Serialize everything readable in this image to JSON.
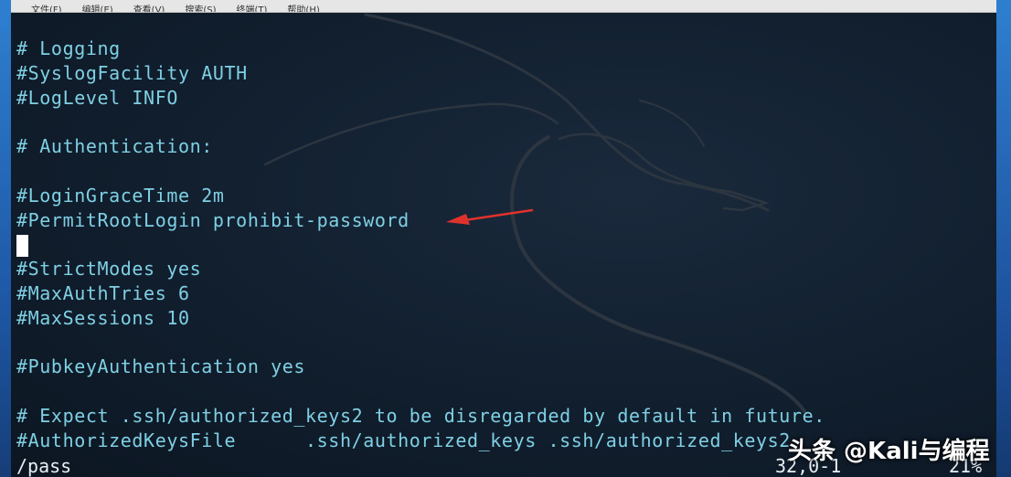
{
  "menubar": {
    "items": [
      "文件(F)",
      "编辑(E)",
      "查看(V)",
      "搜索(S)",
      "终端(T)",
      "帮助(H)"
    ]
  },
  "editor": {
    "lines": [
      "# Logging",
      "#SyslogFacility AUTH",
      "#LogLevel INFO",
      "",
      "# Authentication:",
      "",
      "#LoginGraceTime 2m",
      "#PermitRootLogin prohibit-password",
      "",
      "#StrictModes yes",
      "#MaxAuthTries 6",
      "#MaxSessions 10",
      "",
      "#PubkeyAuthentication yes",
      "",
      "# Expect .ssh/authorized_keys2 to be disregarded by default in future.",
      "#AuthorizedKeysFile      .ssh/authorized_keys .ssh/authorized_keys2"
    ],
    "cursor_line_index": 8
  },
  "status": {
    "command": "/pass",
    "position": "32,0-1",
    "percent": "21%"
  },
  "watermark": {
    "text": "头条 @Kali与编程"
  },
  "colors": {
    "text": "#7fd0e4",
    "background": "#101c2c",
    "arrow": "#e0322c"
  },
  "icons": {
    "annotation": "red-arrow-icon",
    "cursor": "block-cursor"
  }
}
